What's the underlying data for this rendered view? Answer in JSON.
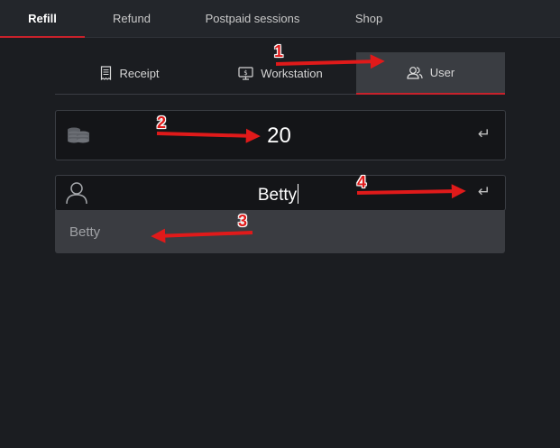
{
  "top_tabs": [
    {
      "label": "Refill",
      "active": true
    },
    {
      "label": "Refund",
      "active": false
    },
    {
      "label": "Postpaid sessions",
      "active": false
    },
    {
      "label": "Shop",
      "active": false
    }
  ],
  "sub_tabs": [
    {
      "label": "Receipt",
      "icon": "receipt-icon",
      "active": false
    },
    {
      "label": "Workstation",
      "icon": "monitor-dollar-icon",
      "active": false
    },
    {
      "label": "User",
      "icon": "users-icon",
      "active": true
    }
  ],
  "amount_field": {
    "icon": "coins-icon",
    "value": "20",
    "enter_icon": "enter-icon"
  },
  "user_field": {
    "icon": "user-icon",
    "value": "Betty",
    "enter_icon": "enter-icon"
  },
  "suggestion": {
    "items": [
      "Betty"
    ]
  },
  "annotations": [
    "1",
    "2",
    "3",
    "4"
  ],
  "colors": {
    "accent": "#c8212b",
    "arrow": "#e01a1a",
    "background": "#1b1d21"
  }
}
